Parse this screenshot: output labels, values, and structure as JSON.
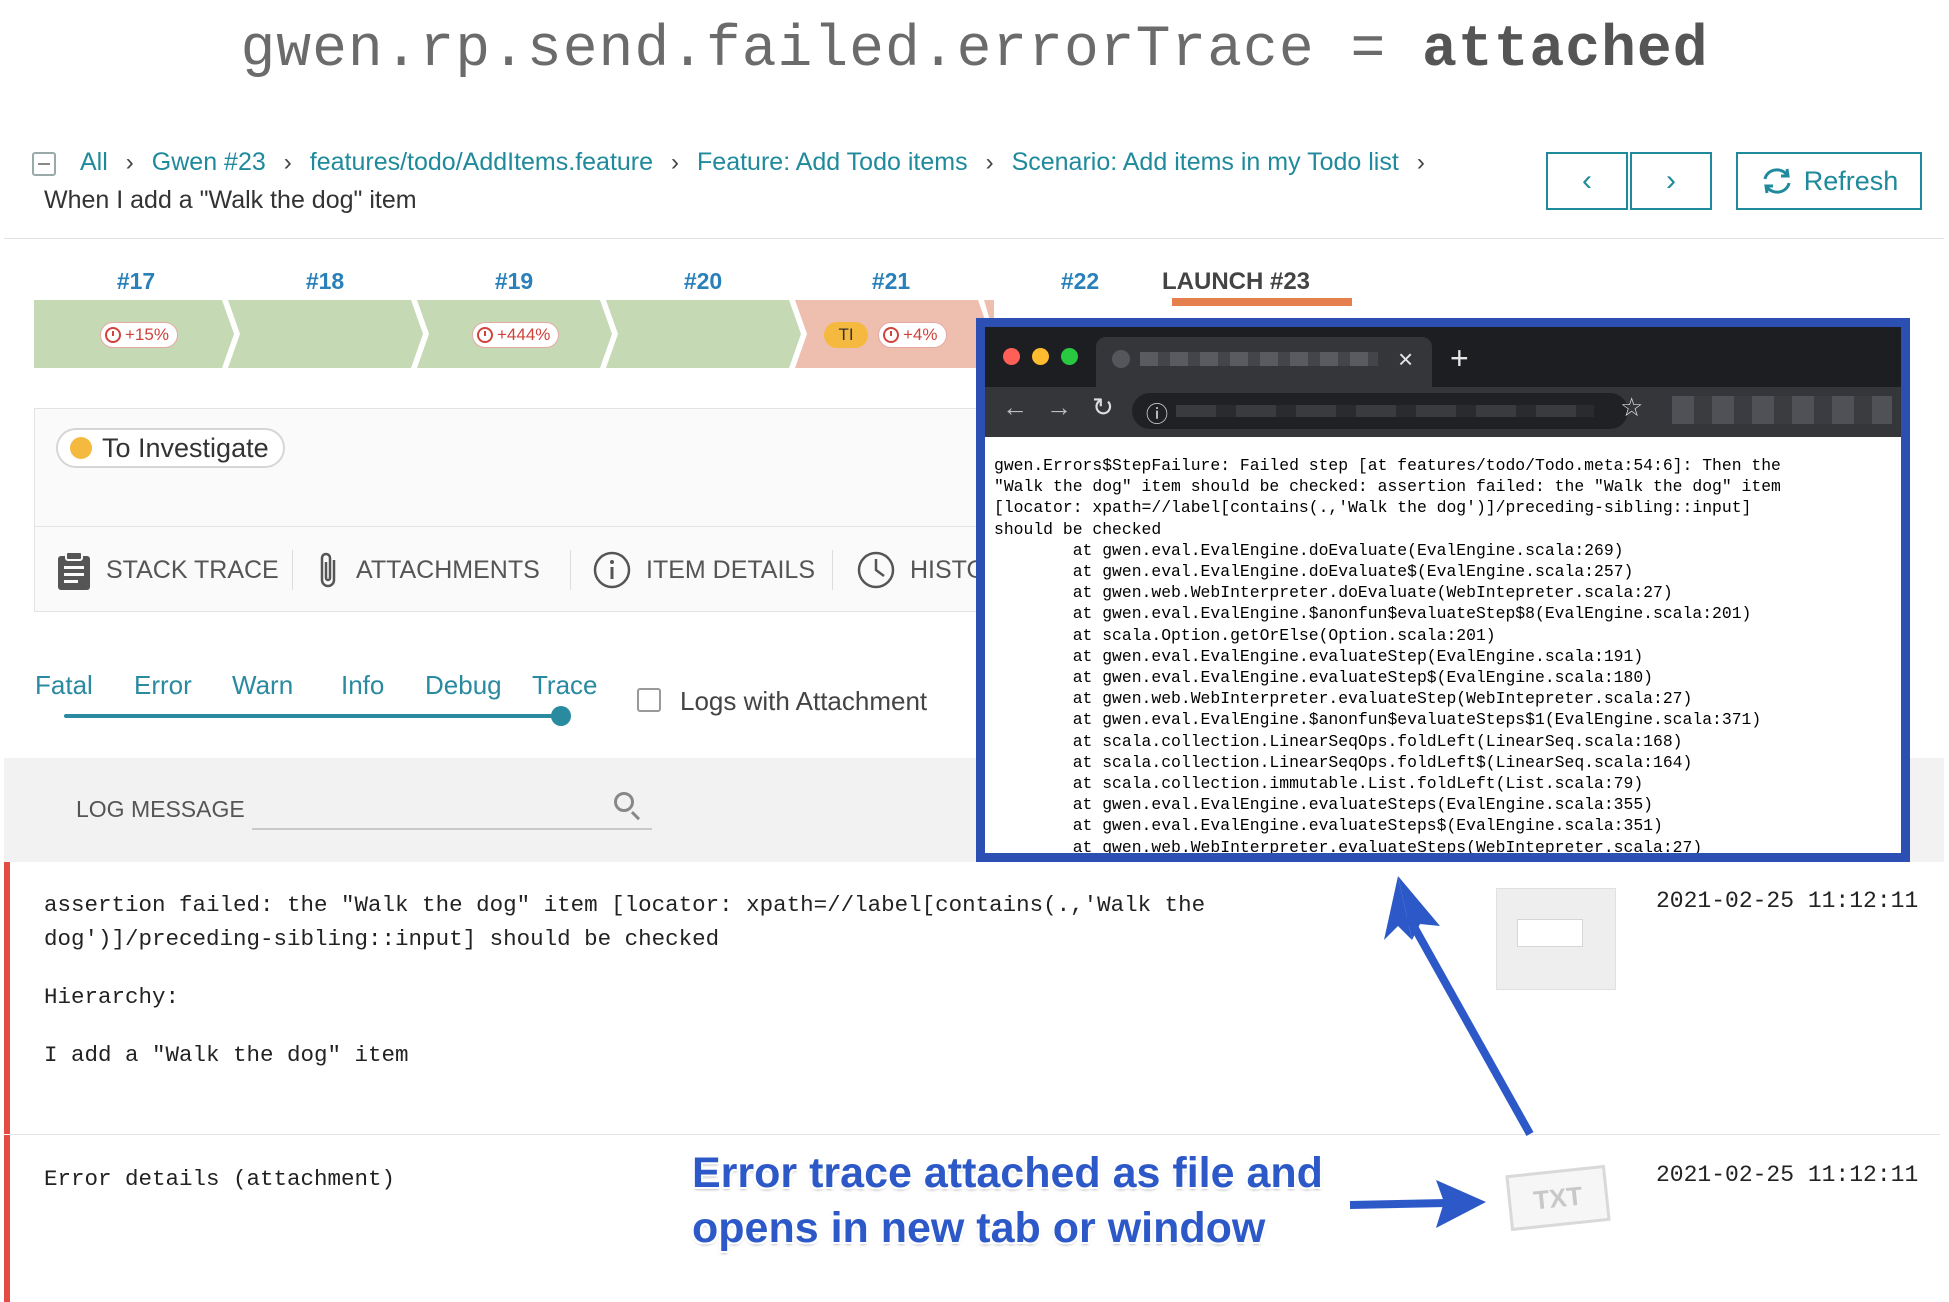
{
  "headline": {
    "key": "gwen.rp.send.failed.errorTrace",
    "operator": "=",
    "value": "attached"
  },
  "breadcrumb": {
    "items": [
      "All",
      "Gwen #23",
      "features/todo/AddItems.feature",
      "Feature: Add Todo items",
      "Scenario: Add items in my Todo list"
    ],
    "current_step": "When I add a \"Walk the dog\" item"
  },
  "nav": {
    "prev_icon": "‹",
    "next_icon": "›",
    "refresh_label": "Refresh"
  },
  "launches": {
    "items": [
      {
        "label": "#17",
        "badge": "+15%"
      },
      {
        "label": "#18",
        "badge": ""
      },
      {
        "label": "#19",
        "badge": "+444%"
      },
      {
        "label": "#20",
        "badge": ""
      },
      {
        "label": "#21",
        "badge": "+4%",
        "defect_badge": "TI"
      },
      {
        "label": "#22",
        "badge": ""
      }
    ],
    "current_label": "LAUNCH #23",
    "colors": {
      "passed": "#c4d9b4",
      "failed": "#eebfaf",
      "current": "#e57f4e"
    }
  },
  "defect": {
    "status": "To Investigate",
    "status_color": "#f5b93f"
  },
  "tabs": [
    "STACK TRACE",
    "ATTACHMENTS",
    "ITEM DETAILS",
    "HISTO"
  ],
  "log_levels": {
    "items": [
      "Fatal",
      "Error",
      "Warn",
      "Info",
      "Debug",
      "Trace"
    ],
    "selected": "Trace",
    "logs_with_attachment_label": "Logs with Attachment"
  },
  "log_table": {
    "header": "LOG MESSAGE",
    "rows": [
      {
        "message_lines": [
          "assertion failed: the \"Walk the dog\" item [locator: xpath=//label[contains(.,'Walk the",
          "dog')]/preceding-sibling::input] should be checked",
          "Hierarchy:",
          "I add a \"Walk the dog\" item"
        ],
        "timestamp": "2021-02-25 11:12:11"
      },
      {
        "message_lines": [
          "Error details (attachment)"
        ],
        "timestamp": "2021-02-25 11:12:11",
        "attachment_label": "TXT"
      }
    ]
  },
  "browser": {
    "trace": "gwen.Errors$StepFailure: Failed step [at features/todo/Todo.meta:54:6]: Then the\n\"Walk the dog\" item should be checked: assertion failed: the \"Walk the dog\" item\n[locator: xpath=//label[contains(.,'Walk the dog')]/preceding-sibling::input]\nshould be checked\n        at gwen.eval.EvalEngine.doEvaluate(EvalEngine.scala:269)\n        at gwen.eval.EvalEngine.doEvaluate$(EvalEngine.scala:257)\n        at gwen.web.WebInterpreter.doEvaluate(WebIntepreter.scala:27)\n        at gwen.eval.EvalEngine.$anonfun$evaluateStep$8(EvalEngine.scala:201)\n        at scala.Option.getOrElse(Option.scala:201)\n        at gwen.eval.EvalEngine.evaluateStep(EvalEngine.scala:191)\n        at gwen.eval.EvalEngine.evaluateStep$(EvalEngine.scala:180)\n        at gwen.web.WebInterpreter.evaluateStep(WebIntepreter.scala:27)\n        at gwen.eval.EvalEngine.$anonfun$evaluateSteps$1(EvalEngine.scala:371)\n        at scala.collection.LinearSeqOps.foldLeft(LinearSeq.scala:168)\n        at scala.collection.LinearSeqOps.foldLeft$(LinearSeq.scala:164)\n        at scala.collection.immutable.List.foldLeft(List.scala:79)\n        at gwen.eval.EvalEngine.evaluateSteps(EvalEngine.scala:355)\n        at gwen.eval.EvalEngine.evaluateSteps$(EvalEngine.scala:351)\n        at gwen.web.WebInterpreter.evaluateSteps(WebIntepreter.scala:27)"
  },
  "annotation": {
    "line1": "Error trace attached as file and",
    "line2": "opens in new tab or window",
    "color": "#2c59c7"
  }
}
